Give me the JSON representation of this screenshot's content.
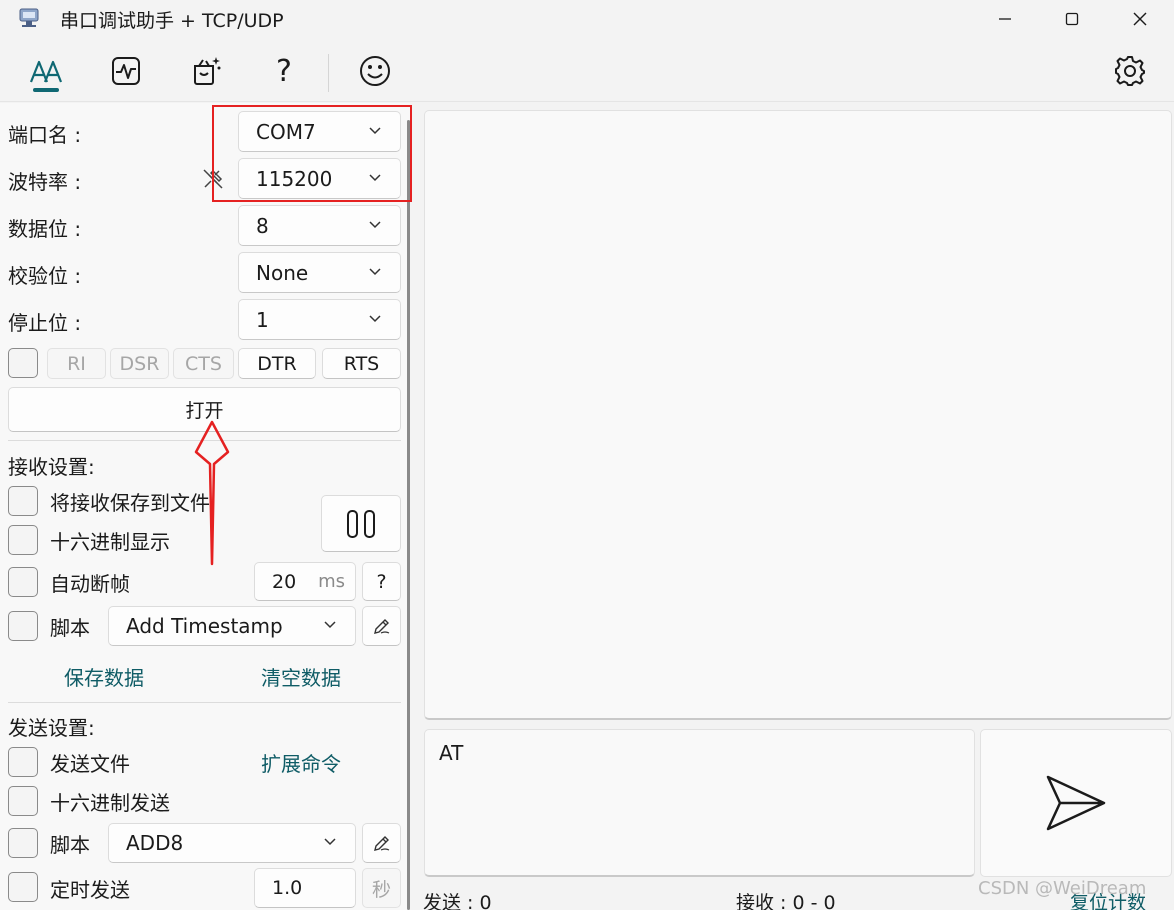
{
  "window": {
    "title": "串口调试助手 + TCP/UDP"
  },
  "toolbar": {
    "items": [
      {
        "icon": "text-font-icon",
        "active": true
      },
      {
        "icon": "waveform-icon"
      },
      {
        "icon": "magic-box-icon"
      },
      {
        "icon": "help-icon",
        "glyph": "?"
      },
      {
        "icon": "smiley-icon"
      }
    ],
    "settings_icon": "gear-icon"
  },
  "serial": {
    "port_label": "端口名 :",
    "port_value": "COM7",
    "baud_label": "波特率 :",
    "baud_value": "115200",
    "databits_label": "数据位 :",
    "databits_value": "8",
    "parity_label": "校验位 :",
    "parity_value": "None",
    "stopbits_label": "停止位 :",
    "stopbits_value": "1",
    "signals": {
      "ri": "RI",
      "dsr": "DSR",
      "cts": "CTS",
      "dtr": "DTR",
      "rts": "RTS"
    },
    "open_button": "打开"
  },
  "receive": {
    "heading": "接收设置:",
    "save_to_file": "将接收保存到文件",
    "hex_display": "十六进制显示",
    "auto_frame": "自动断帧",
    "frame_ms": "20",
    "frame_unit": "ms",
    "frame_help": "?",
    "script_label": "脚本",
    "script_value": "Add Timestamp",
    "save_data": "保存数据",
    "clear_data": "清空数据"
  },
  "send": {
    "heading": "发送设置:",
    "send_file": "发送文件",
    "ext_commands": "扩展命令",
    "hex_send": "十六进制发送",
    "script_label": "脚本",
    "script_value": "ADD8",
    "timed_send": "定时发送",
    "interval": "1.0",
    "interval_unit": "秒",
    "input_text": "AT"
  },
  "statusbar": {
    "sent_label": "发送 :",
    "sent_value": "0",
    "recv_label": "接收 :",
    "recv_value": "0 - 0",
    "reset": "复位计数"
  },
  "watermark": "CSDN @WeiDream",
  "colors": {
    "accent": "#0f6873",
    "link": "#0f5c66",
    "annotation_red": "#e52121"
  }
}
